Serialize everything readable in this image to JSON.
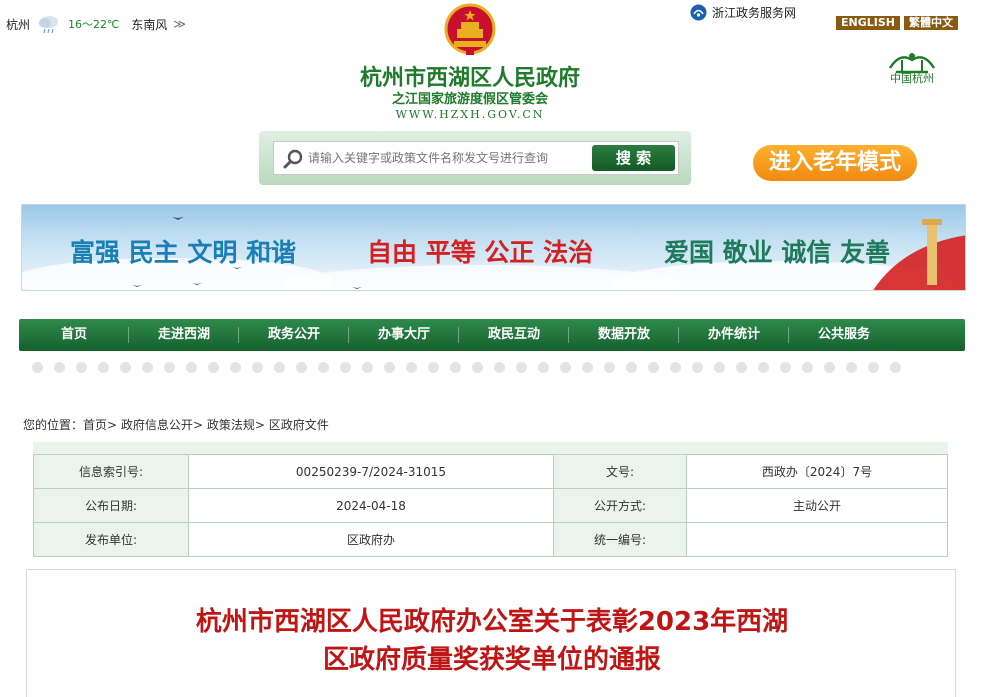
{
  "weather": {
    "city": "杭州",
    "temp": "16～22℃",
    "wind": "东南风",
    "more": "≫",
    "icon": "rain-cloud-icon"
  },
  "links": {
    "zj_gov": "浙江政务服务网",
    "english": "ENGLISH",
    "traditional": "繁體中文"
  },
  "header": {
    "title": "杭州市西湖区人民政府",
    "subtitle": "之江国家旅游度假区管委会",
    "url": "WWW.HZXH.GOV.CN",
    "hz_logo_text": "中国杭州"
  },
  "search": {
    "placeholder": "请输入关键字或政策文件名称发文号进行查询",
    "button": "搜 索"
  },
  "elder_mode": "进入老年模式",
  "banner": {
    "group1": "富强 民主 文明 和谐",
    "group2": "自由 平等 公正 法治",
    "group3": "爱国 敬业 诚信 友善"
  },
  "nav": [
    "首页",
    "走进西湖",
    "政务公开",
    "办事大厅",
    "政民互动",
    "数据开放",
    "办件统计",
    "公共服务"
  ],
  "breadcrumb": {
    "prefix": "您的位置：",
    "items": [
      "首页",
      "政府信息公开",
      "政策法规",
      "区政府文件"
    ],
    "sep": ">"
  },
  "info": {
    "index_label": "信息索引号:",
    "index_value": "00250239-7/2024-31015",
    "docno_label": "文号:",
    "docno_value": "西政办〔2024〕7号",
    "date_label": "公布日期:",
    "date_value": "2024-04-18",
    "mode_label": "公开方式:",
    "mode_value": "主动公开",
    "unit_label": "发布单位:",
    "unit_value": "区政府办",
    "serial_label": "统一编号:",
    "serial_value": ""
  },
  "article": {
    "title_line1": "杭州市西湖区人民政府办公室关于表彰2023年西湖",
    "title_line2": "区政府质量奖获奖单位的通报"
  },
  "colors": {
    "green": "#1f7a2b",
    "nav_green": "#15612d",
    "title_red": "#c01515",
    "orange": "#f08a10"
  }
}
